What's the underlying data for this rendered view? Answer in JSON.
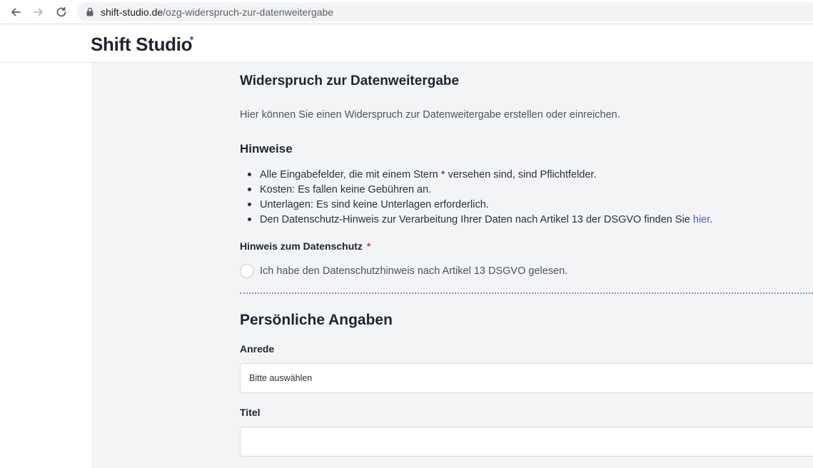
{
  "browser": {
    "url_host": "shift-studio.de",
    "url_path": "/ozg-widerspruch-zur-datenweitergabe"
  },
  "site": {
    "logo_text": "Shift Studio",
    "accent_color": "#5b6fd6"
  },
  "page": {
    "title": "Widerspruch zur Datenweitergabe",
    "intro": "Hier können Sie einen Widerspruch zur Datenweitergabe erstellen oder einreichen.",
    "hints_title": "Hinweise",
    "hints": [
      "Alle Eingabefelder, die mit einem Stern * versehen sind, sind Pflichtfelder.",
      "Kosten: Es fallen keine Gebühren an.",
      "Unterlagen: Es sind keine Unterlagen erforderlich.",
      "Den Datenschutz-Hinweis zur Verarbeitung Ihrer Daten nach Artikel 13 der DSGVO finden Sie "
    ],
    "hint_link_text": "hier",
    "hint_link_suffix": ".",
    "privacy": {
      "label": "Hinweis zum Datenschutz",
      "required_marker": "*",
      "checkbox_text": "Ich habe den Datenschutzhinweis nach Artikel 13 DSGVO gelesen.",
      "checked": false
    }
  },
  "personal": {
    "section_title": "Persönliche Angaben",
    "anrede_label": "Anrede",
    "anrede_value": "Bitte auswählen",
    "titel_label": "Titel",
    "titel_value": ""
  }
}
